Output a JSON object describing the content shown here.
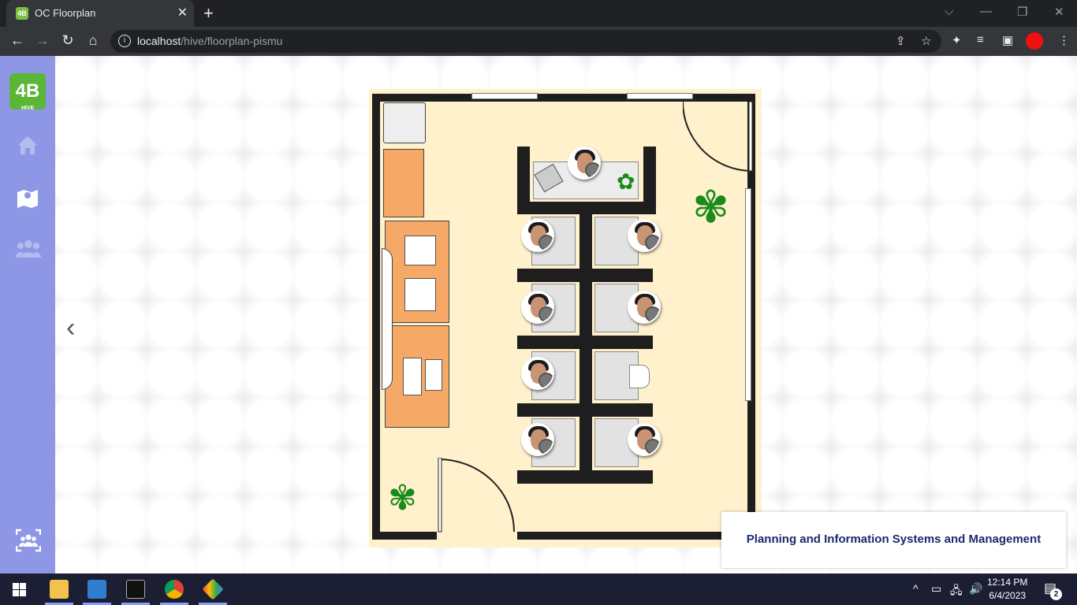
{
  "browser": {
    "tab_title": "OC Floorplan",
    "tab_close": "✕",
    "new_tab": "+",
    "url_host": "localhost",
    "url_path": "/hive/floorplan-pismu",
    "controls": {
      "dropdown": "⌵",
      "minimize": "—",
      "restore": "❐",
      "close": "✕"
    }
  },
  "sidebar": {
    "logo_text": "4B",
    "logo_sub": "HIVE",
    "items": [
      {
        "name": "home-icon",
        "glyph": "⌂"
      },
      {
        "name": "map-icon",
        "glyph": "⛶"
      },
      {
        "name": "users-icon",
        "glyph": "👥"
      },
      {
        "name": "team-scan-icon",
        "glyph": "⛶"
      }
    ]
  },
  "floorplan": {
    "prev_arrow": "‹",
    "department": "Planning and Information Systems and Management"
  },
  "taskbar": {
    "time": "12:14 PM",
    "date": "6/4/2023",
    "notifications": "2"
  },
  "colors": {
    "sidebar": "#8e97e6",
    "floor": "#fff1cc",
    "desk_orange": "#f6a866",
    "accent_text": "#1a2a6c"
  }
}
